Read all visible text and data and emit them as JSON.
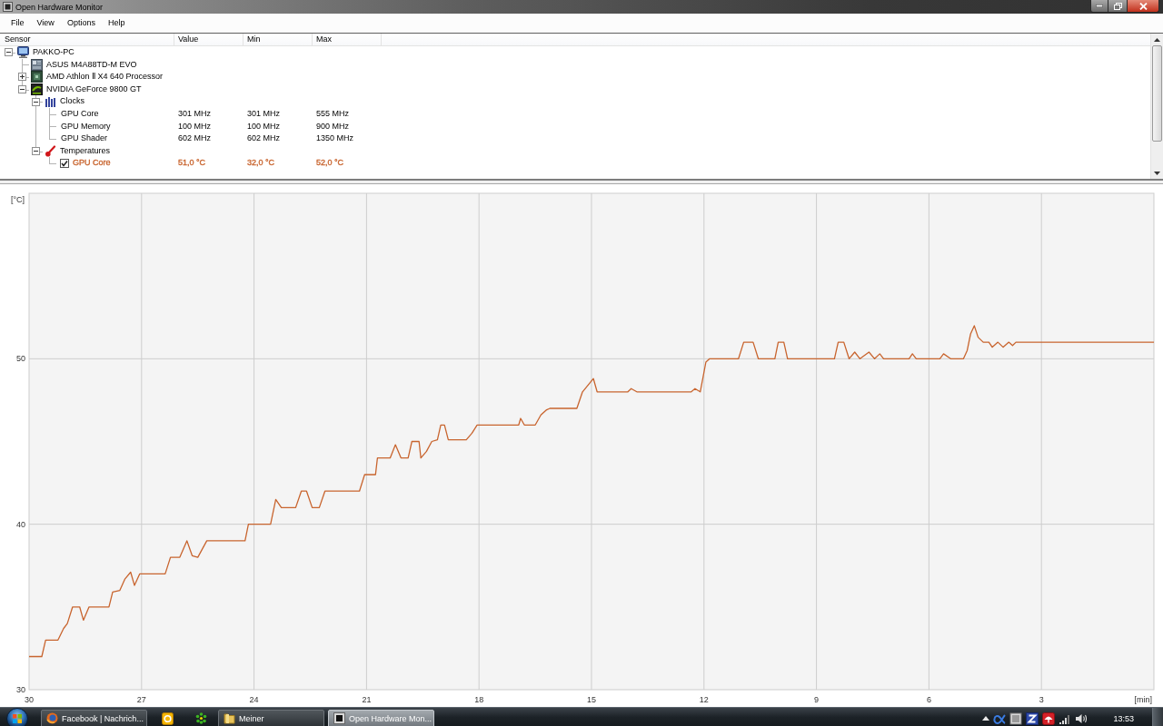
{
  "window": {
    "title": "Open Hardware Monitor"
  },
  "menu": [
    "File",
    "View",
    "Options",
    "Help"
  ],
  "sensor_tree": {
    "columns": [
      "Sensor",
      "Value",
      "Min",
      "Max"
    ],
    "nodes": [
      {
        "kind": "computer",
        "label": "PAKKO-PC",
        "expanded": true,
        "children": [
          {
            "kind": "mainboard",
            "label": "ASUS M4A88TD-M EVO"
          },
          {
            "kind": "cpu",
            "label": "AMD Athlon Ⅱ X4 640 Processor",
            "expanded": false
          },
          {
            "kind": "gpu",
            "label": "NVIDIA GeForce 9800 GT",
            "expanded": true,
            "children": [
              {
                "kind": "clocks",
                "label": "Clocks",
                "expanded": true,
                "children": [
                  {
                    "kind": "sensor",
                    "label": "GPU Core",
                    "value": "301 MHz",
                    "min": "301 MHz",
                    "max": "555 MHz"
                  },
                  {
                    "kind": "sensor",
                    "label": "GPU Memory",
                    "value": "100 MHz",
                    "min": "100 MHz",
                    "max": "900 MHz"
                  },
                  {
                    "kind": "sensor",
                    "label": "GPU Shader",
                    "value": "602 MHz",
                    "min": "602 MHz",
                    "max": "1350 MHz"
                  }
                ]
              },
              {
                "kind": "temperatures",
                "label": "Temperatures",
                "expanded": true,
                "children": [
                  {
                    "kind": "sensor",
                    "label": "GPU Core",
                    "value": "51,0 °C",
                    "min": "32,0 °C",
                    "max": "52,0 °C",
                    "checked": true,
                    "color": "#c8642e"
                  }
                ]
              }
            ]
          }
        ]
      }
    ]
  },
  "plot": {
    "chart_data": {
      "type": "line",
      "xlabel": "[min]",
      "ylabel": "[°C]",
      "grid": true,
      "xlim": [
        30,
        0
      ],
      "ylim": [
        30,
        60
      ],
      "xticks": [
        30,
        27,
        24,
        21,
        18,
        15,
        12,
        9,
        6,
        3
      ],
      "yticks": [
        30,
        40,
        50
      ],
      "x": [
        30,
        29.66,
        29.56,
        29.23,
        29.08,
        28.98,
        28.84,
        28.65,
        28.55,
        28.4,
        27.87,
        27.77,
        27.58,
        27.44,
        27.29,
        27.19,
        27.05,
        26.37,
        26.23,
        25.98,
        25.79,
        25.65,
        25.5,
        25.26,
        24.24,
        24.15,
        23.56,
        23.42,
        23.27,
        22.89,
        22.74,
        22.6,
        22.45,
        22.26,
        22.11,
        21.19,
        21.05,
        20.76,
        20.71,
        20.37,
        20.23,
        20.08,
        19.89,
        19.79,
        19.6,
        19.55,
        19.4,
        19.26,
        19.11,
        19.02,
        18.92,
        18.82,
        18.34,
        18.19,
        18.05,
        16.94,
        16.89,
        16.79,
        16.5,
        16.35,
        16.21,
        16.11,
        15.39,
        15.24,
        14.95,
        14.85,
        14.03,
        13.94,
        13.79,
        12.34,
        12.24,
        12.1,
        11.95,
        11.85,
        11.08,
        10.94,
        10.69,
        10.55,
        10.11,
        10.02,
        9.87,
        9.77,
        8.52,
        8.42,
        8.27,
        8.13,
        7.98,
        7.84,
        7.6,
        7.45,
        7.31,
        7.21,
        6.53,
        6.44,
        6.34,
        5.71,
        5.61,
        5.42,
        5.08,
        4.98,
        4.89,
        4.79,
        4.69,
        4.55,
        4.4,
        4.31,
        4.16,
        4.02,
        3.87,
        3.77,
        3.68,
        0
      ],
      "series": [
        {
          "color": "#c8642e",
          "values": [
            32,
            32,
            33,
            33,
            33.7,
            34,
            35,
            35,
            34.2,
            35,
            35,
            35.9,
            36,
            36.7,
            37.1,
            36.3,
            37,
            37,
            38,
            38,
            39,
            38.1,
            38,
            39,
            39,
            40,
            40,
            41.5,
            41,
            41,
            42,
            42,
            41,
            41,
            42,
            42,
            43,
            43,
            44,
            44,
            44.8,
            44,
            44,
            45,
            45,
            44,
            44.4,
            45,
            45.1,
            46,
            46,
            45.1,
            45.1,
            45.5,
            46,
            46,
            46.4,
            46,
            46,
            46.6,
            46.9,
            47,
            47,
            48,
            48.8,
            48,
            48,
            48.2,
            48,
            48,
            48.2,
            48,
            49.8,
            50,
            50,
            51,
            51,
            50,
            50,
            51,
            51,
            50,
            50,
            51,
            51,
            50,
            50.4,
            50,
            50.4,
            50,
            50.3,
            50,
            50,
            50.3,
            50,
            50,
            50.3,
            50,
            50,
            50.5,
            51.5,
            52,
            51.3,
            51,
            51,
            50.7,
            51,
            50.7,
            51,
            50.8,
            51,
            51
          ]
        }
      ]
    }
  },
  "taskbar": {
    "items": [
      {
        "kind": "browser",
        "label": "Facebook | Nachrich...",
        "selected": false
      },
      {
        "kind": "mail",
        "selected": false
      },
      {
        "kind": "messenger",
        "selected": false
      },
      {
        "kind": "folder",
        "label": "Meiner",
        "selected": false
      },
      {
        "kind": "app",
        "label": "Open Hardware Mon...",
        "selected": true
      }
    ],
    "clock": "13:53"
  }
}
